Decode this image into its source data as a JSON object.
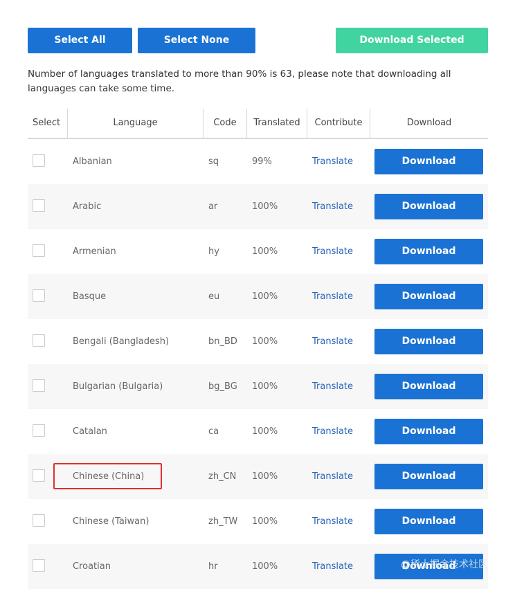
{
  "toolbar": {
    "select_all": "Select All",
    "select_none": "Select None",
    "download_selected": "Download Selected"
  },
  "note": "Number of languages translated to more than 90% is 63, please note that downloading all languages can take some time.",
  "table": {
    "headers": {
      "select": "Select",
      "language": "Language",
      "code": "Code",
      "translated": "Translated",
      "contribute": "Contribute",
      "download": "Download"
    },
    "rows": [
      {
        "language": "Albanian",
        "code": "sq",
        "translated": "99%",
        "contribute": "Translate",
        "download": "Download"
      },
      {
        "language": "Arabic",
        "code": "ar",
        "translated": "100%",
        "contribute": "Translate",
        "download": "Download"
      },
      {
        "language": "Armenian",
        "code": "hy",
        "translated": "100%",
        "contribute": "Translate",
        "download": "Download"
      },
      {
        "language": "Basque",
        "code": "eu",
        "translated": "100%",
        "contribute": "Translate",
        "download": "Download"
      },
      {
        "language": "Bengali (Bangladesh)",
        "code": "bn_BD",
        "translated": "100%",
        "contribute": "Translate",
        "download": "Download"
      },
      {
        "language": "Bulgarian (Bulgaria)",
        "code": "bg_BG",
        "translated": "100%",
        "contribute": "Translate",
        "download": "Download"
      },
      {
        "language": "Catalan",
        "code": "ca",
        "translated": "100%",
        "contribute": "Translate",
        "download": "Download"
      },
      {
        "language": "Chinese (China)",
        "code": "zh_CN",
        "translated": "100%",
        "contribute": "Translate",
        "download": "Download"
      },
      {
        "language": "Chinese (Taiwan)",
        "code": "zh_TW",
        "translated": "100%",
        "contribute": "Translate",
        "download": "Download"
      },
      {
        "language": "Croatian",
        "code": "hr",
        "translated": "100%",
        "contribute": "Translate",
        "download": "Download"
      }
    ]
  },
  "watermark": "@稀土掘金技术社区",
  "colors": {
    "primary": "#1a73d4",
    "success": "#41d3a0",
    "link": "#2a63b8",
    "highlight": "#e0312c"
  }
}
